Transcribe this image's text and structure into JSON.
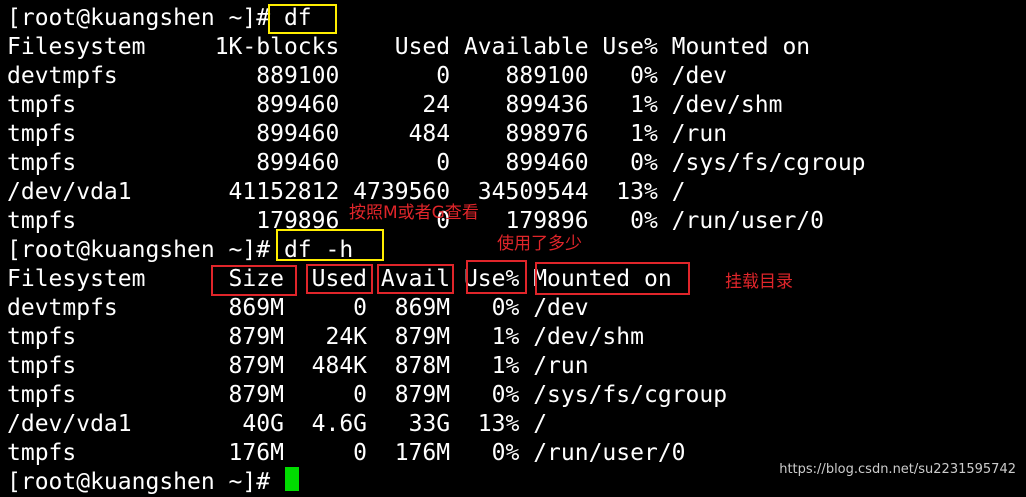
{
  "terminal": {
    "lines": [
      "[root@kuangshen ~]# df",
      "Filesystem     1K-blocks    Used Available Use% Mounted on",
      "devtmpfs          889100       0    889100   0% /dev",
      "tmpfs             899460      24    899436   1% /dev/shm",
      "tmpfs             899460     484    898976   1% /run",
      "tmpfs             899460       0    899460   0% /sys/fs/cgroup",
      "/dev/vda1       41152812 4739560  34509544  13% /",
      "tmpfs             179896       0    179896   0% /run/user/0",
      "[root@kuangshen ~]# df -h",
      "Filesystem      Size  Used Avail Use% Mounted on",
      "devtmpfs        869M     0  869M   0% /dev",
      "tmpfs           879M   24K  879M   1% /dev/shm",
      "tmpfs           879M  484K  878M   1% /run",
      "tmpfs           879M     0  879M   0% /sys/fs/cgroup",
      "/dev/vda1        40G  4.6G   33G  13% /",
      "tmpfs           176M     0  176M   0% /run/user/0",
      "[root@kuangshen ~]# "
    ]
  },
  "annotations": {
    "note_m_or_g": "按照M或者G查看",
    "note_used": "使用了多少",
    "note_mount_dir": "挂载目录"
  },
  "watermark": "https://blog.csdn.net/su2231595742",
  "colors": {
    "background": "#000000",
    "text": "#ffffff",
    "highlight_yellow": "#ffee00",
    "annotation_red": "#e0252a",
    "cursor": "#00dd00"
  }
}
